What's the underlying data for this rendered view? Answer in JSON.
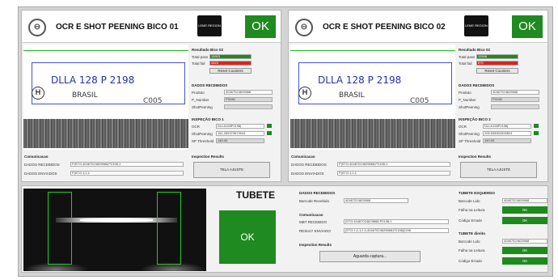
{
  "panel1": {
    "title": "OCR E SHOT PEENING BICO 01",
    "ok": "OK",
    "brand": "LEME REGION",
    "plate": {
      "line1": "DLLA 128 P  2198",
      "line2": "BRASIL",
      "code": "C005"
    },
    "results": {
      "title": "Resultado Bico 02",
      "total_pass_label": "Total pass",
      "total_pass": "15903",
      "total_fail_label": "Total fail",
      "total_fail": "2823",
      "reset": "Reset Counters"
    },
    "dados": {
      "title": "DADOS RECEBIDOS",
      "produto_label": "Produto",
      "produto": "40467024629868",
      "pn_label": "P_Number",
      "pn": "P3198",
      "shot_label": "ShotPeening",
      "shot": ""
    },
    "inspecao": {
      "title": "INSPEÇÃO BICO 1",
      "ocr_label": "OCR",
      "ocr": "DLLA128P2198|",
      "shot_label": "ShotPeening",
      "shot": "161.265373673044",
      "thr_label": "SP Threshold",
      "thr": "140.00"
    },
    "comm": {
      "title": "Comunicacao",
      "recv_label": "DADOS RECEBIDOS",
      "recv": "P|STG:40467024629868;P2198;1",
      "sent_label": "DADOS ENVIADOS",
      "sent": "P|STG:1;1;1"
    },
    "insp_results": {
      "title": "Inspection Results",
      "button": "TELA AJUSTE"
    }
  },
  "panel2": {
    "title": "OCR E SHOT PEENING BICO 02",
    "ok": "OK",
    "brand": "LEME REGION",
    "plate": {
      "line1": "DLLA 128 P  2198",
      "line2": "BRASIL",
      "code": "C005"
    },
    "results": {
      "title": "Resultado Bico 02",
      "total_pass_label": "Total pass",
      "total_pass": "15908",
      "total_fail_label": "Total fail",
      "total_fail": "870",
      "reset": "Reset Counters"
    },
    "dados": {
      "title": "DADOS RECEBIDOS",
      "produto_label": "Produto",
      "produto": "40467024629868",
      "pn_label": "P_Number",
      "pn": "P3198",
      "shot_label": "ShotPeening",
      "shot": ""
    },
    "inspecao": {
      "title": "INSPEÇÃO BICO 2",
      "ocr_label": "OCR",
      "ocr": "DLLA128P2198|",
      "shot_label": "ShotPeening",
      "shot": "205.638303390824",
      "thr_label": "SP Threshold",
      "thr": "140.00"
    },
    "comm": {
      "title": "Comunicacao",
      "recv_label": "DADOS RECEBIDOS",
      "recv": "P|STG:40467024629868;P2198;1",
      "sent_label": "DADOS ENVIADOS",
      "sent": "P|STG:1;1;1"
    },
    "insp_results": {
      "title": "Inspection Results",
      "button": "TELA AJUSTE"
    }
  },
  "tubete": {
    "title": "TUBETE",
    "ok": "OK",
    "dados": {
      "title": "DADOS RECEBIDOS",
      "barcode_label": "Barcode Recebido",
      "barcode": "40467024629868"
    },
    "comm": {
      "title": "Comunicacao",
      "recv_label": "MBT RECEBIDO",
      "recv": "|STG:40467024629868;P2198;1",
      "sent_label": "RESULT ENVIADO",
      "sent": "|STG:1;1;1;1;1;40467024629868;P2198|2198"
    },
    "insp": {
      "title": "Inspection Results",
      "button": "Aguarda captura..."
    },
    "esq": {
      "title": "TUBETE ESQUERDO",
      "barcode_label": "Barcode Lido",
      "barcode": "40467024629868",
      "falha_label": "Falha na Leitura",
      "falha": "OK",
      "codigo_label": "Código Errado",
      "codigo": "OK"
    },
    "dir": {
      "title": "TUBETE direito",
      "barcode_label": "Barcode Lido",
      "barcode": "40467024629868",
      "falha_label": "Falha na Leitura",
      "falha": "OK",
      "codigo_label": "Código Errado",
      "codigo": "OK"
    }
  },
  "colors": {
    "green": "#1e8a1e",
    "red": "#dd2222"
  }
}
